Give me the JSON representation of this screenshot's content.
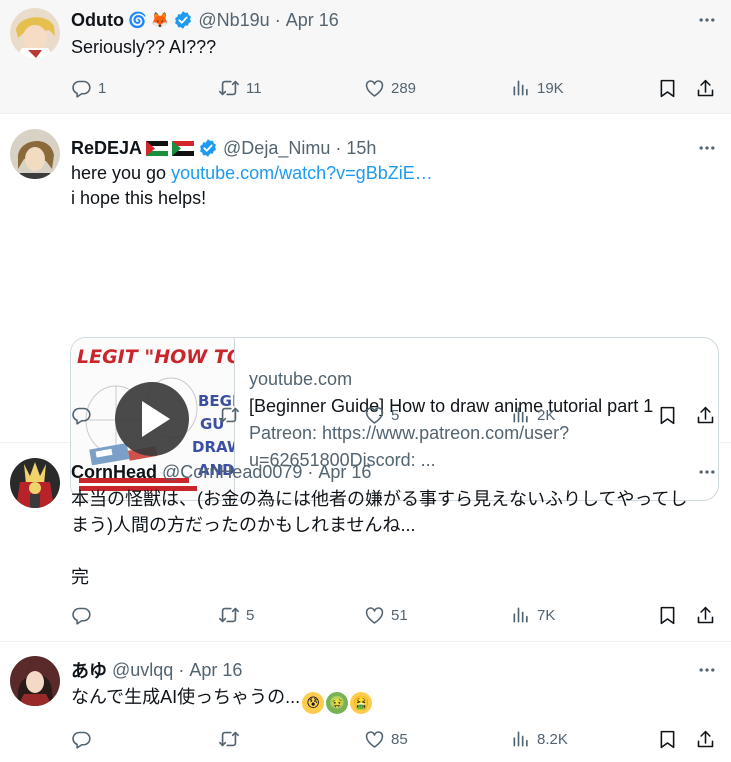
{
  "tweets": [
    {
      "name": "Oduto",
      "badges": [
        "🌀",
        "🦊"
      ],
      "handle": "@Nb19u",
      "time": "Apr 16",
      "lines": [
        "Seriously?? AI???"
      ],
      "replies": "1",
      "retweets": "11",
      "likes": "289",
      "views": "19K"
    },
    {
      "name": "ReDEJA",
      "handle": "@Deja_Nimu",
      "time": "15h",
      "text_prefix": "here you go ",
      "link": "youtube.com/watch?v=gBbZiE…",
      "line2": "i hope this helps!",
      "card": {
        "thumb_title": "LEGIT \"HOW TO D",
        "thumb_side": [
          "BEGI",
          "GU",
          "DRAW",
          "AND A"
        ],
        "domain": "youtube.com",
        "title": "[Beginner Guide] How to draw anime tutorial part 1",
        "desc_1": "Patreon: https://www.patreon.com/user?",
        "desc_2": "u=62651800Discord: ..."
      },
      "replies": "",
      "retweets": "",
      "likes": "5",
      "views": "2K"
    },
    {
      "name": "CornHead",
      "handle": "@CornHead0079",
      "time": "Apr 16",
      "lines": [
        "本当の怪獣は、(お金の為には他者の嫌がる事すら見えないふりしてやってし",
        "まう)人間の方だったのかもしれませんね...",
        "",
        "完"
      ],
      "replies": "",
      "retweets": "5",
      "likes": "51",
      "views": "7K"
    },
    {
      "name": "あゆ",
      "handle": "@uvlqq",
      "time": "Apr 16",
      "text": "なんで生成AI使っちゃうの...",
      "emojis": [
        "😰",
        "🤢",
        "🤮"
      ],
      "replies": "",
      "retweets": "",
      "likes": "85",
      "views": "8.2K"
    }
  ],
  "separator": "·",
  "icons": [
    "reply-icon",
    "retweet-icon",
    "like-icon",
    "views-icon",
    "bookmark-icon",
    "share-icon",
    "more-icon",
    "verified-icon",
    "play-icon"
  ],
  "colors": {
    "link": "#1d9bf0",
    "verified": "#1d9bf0",
    "muted": "#536471",
    "border": "#eff3f4"
  }
}
